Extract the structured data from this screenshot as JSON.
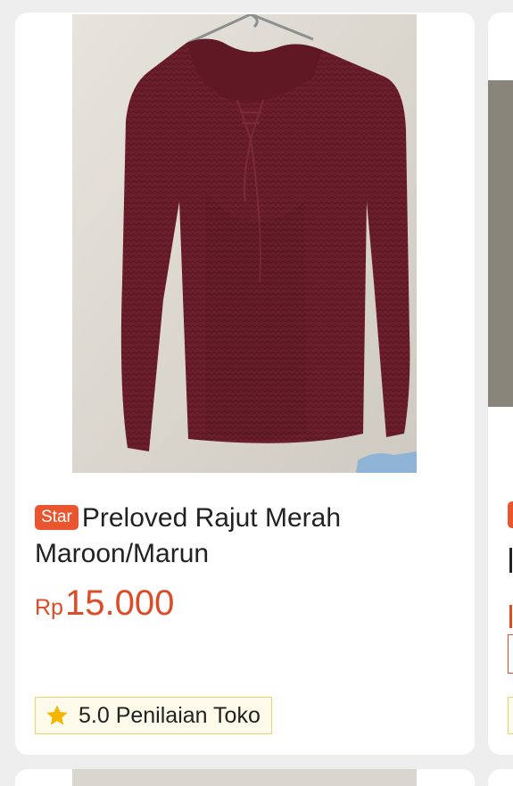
{
  "product": {
    "badge": "Star",
    "title": "Preloved Rajut Merah Maroon/Marun",
    "price_currency": "Rp",
    "price_amount": "15.000",
    "rating_text": "5.0 Penilaian Toko",
    "image_icon": "maroon-knit-sweater-photo"
  },
  "colors": {
    "badge_bg": "#e8552e",
    "price": "#dd4c27",
    "rating_border": "#f3cf6b",
    "rating_bg": "#fffbea",
    "star": "#f4b400"
  }
}
